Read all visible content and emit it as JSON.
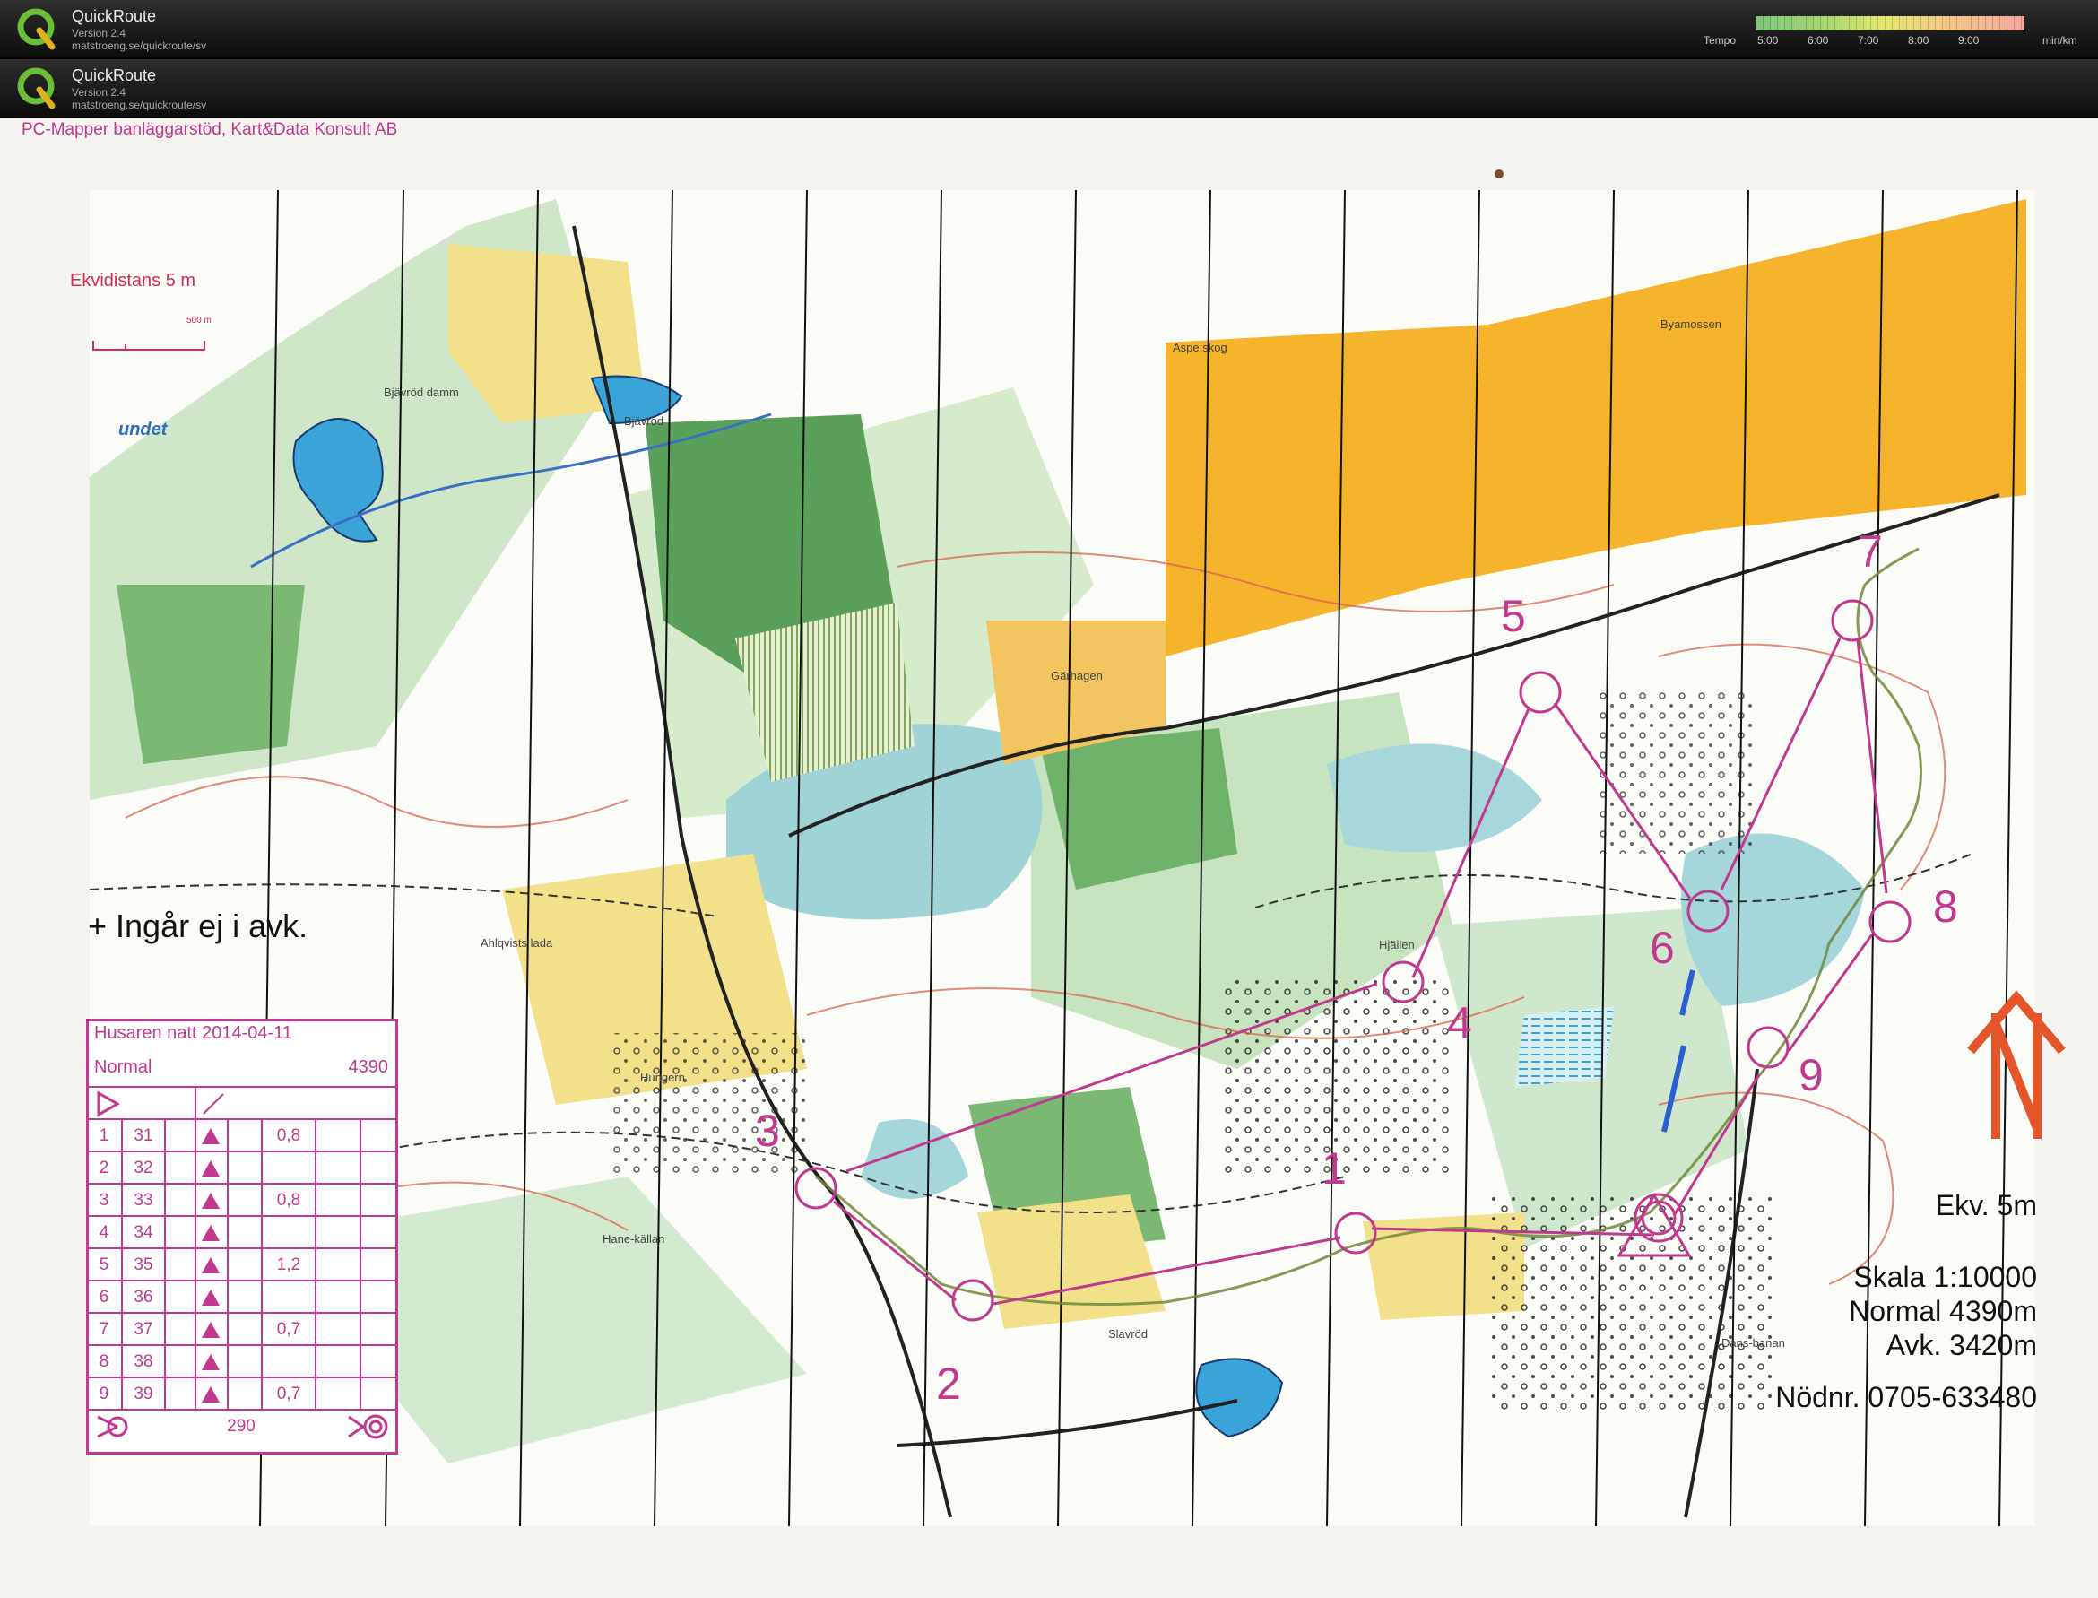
{
  "app": {
    "name": "QuickRoute",
    "version": "Version 2.4",
    "url": "matstroeng.se/quickroute/sv"
  },
  "tempo": {
    "label": "Tempo",
    "ticks": [
      "5:00",
      "6:00",
      "7:00",
      "8:00",
      "9:00"
    ],
    "unit": "min/km"
  },
  "map": {
    "header_credit": "PC-Mapper banläggarstöd, Kart&Data Konsult AB",
    "equidistance_label": "Ekvidistans 5 m",
    "scalebar_label": "500 m",
    "excluded_note": "+ Ingår ej i avk.",
    "water_label": "undet",
    "place_names": [
      "Bjävröd damm",
      "Bjävröd",
      "Aspe skog",
      "Byamossen",
      "Gärhagen",
      "Hjällen",
      "Ahlqvists lada",
      "Hungern",
      "Hane-källan",
      "Slavröd",
      "Dans-banan"
    ],
    "info": {
      "ekv": "Ekv. 5m",
      "scale": "Skala 1:10000",
      "normal": "Normal 4390m",
      "avk": "Avk. 3420m",
      "emergency": "Nödnr. 0705-633480"
    },
    "control_numbers": [
      "1",
      "2",
      "3",
      "4",
      "5",
      "6",
      "7",
      "8",
      "9"
    ],
    "colors": {
      "course": "#c0398e",
      "open_land": "#f6b42c",
      "rough_open": "#f3e08a",
      "forest_green": "#5aa05a",
      "water": "#3aa4d8",
      "marsh": "#8fd2d8",
      "contour": "#d9644a"
    }
  },
  "control_table": {
    "title": "Husaren natt 2014-04-11",
    "class": "Normal",
    "length": "4390",
    "rows": [
      {
        "n": "1",
        "code": "31",
        "dim": "0,8"
      },
      {
        "n": "2",
        "code": "32",
        "dim": ""
      },
      {
        "n": "3",
        "code": "33",
        "dim": "0,8"
      },
      {
        "n": "4",
        "code": "34",
        "dim": ""
      },
      {
        "n": "5",
        "code": "35",
        "dim": "1,2"
      },
      {
        "n": "6",
        "code": "36",
        "dim": ""
      },
      {
        "n": "7",
        "code": "37",
        "dim": "0,7"
      },
      {
        "n": "8",
        "code": "38",
        "dim": ""
      },
      {
        "n": "9",
        "code": "39",
        "dim": "0,7"
      }
    ],
    "finish_distance": "290"
  }
}
